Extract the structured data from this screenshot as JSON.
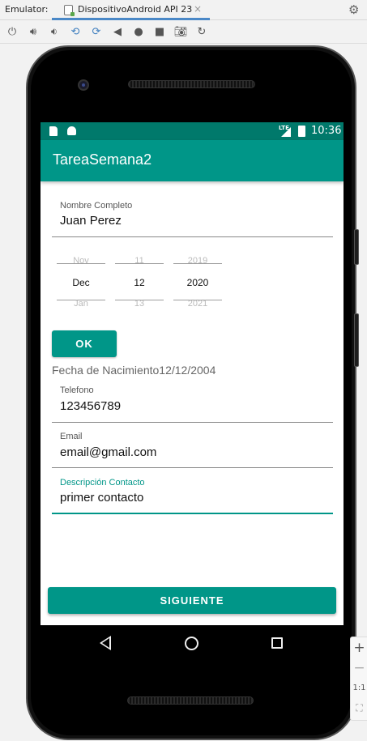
{
  "ide": {
    "emulator_label": "Emulator:",
    "tab_title": "DispositivoAndroid API 23",
    "tab_close": "×",
    "settings_icon": "gear-icon",
    "toolbar_icons": [
      "power-icon",
      "volume-up-icon",
      "volume-down-icon",
      "rotate-left-icon",
      "rotate-right-icon",
      "back-icon",
      "home-icon",
      "overview-icon",
      "screenshot-icon",
      "snapshot-icon"
    ]
  },
  "status_bar": {
    "network": "LTE",
    "time": "10:36"
  },
  "app_bar": {
    "title": "TareaSemana2"
  },
  "form": {
    "nombre": {
      "hint": "Nombre Completo",
      "value": "Juan Perez"
    },
    "date_picker": {
      "month": {
        "prev": "Nov",
        "current": "Dec",
        "next": "Jan"
      },
      "day": {
        "prev": "11",
        "current": "12",
        "next": "13"
      },
      "year": {
        "prev": "2019",
        "current": "2020",
        "next": "2021"
      }
    },
    "ok_button": "OK",
    "fecha_label": "Fecha de Nacimiento12/12/2004",
    "telefono": {
      "hint": "Telefono",
      "value": "123456789"
    },
    "email": {
      "hint": "Email",
      "value": "email@gmail.com"
    },
    "descripcion": {
      "hint": "Descripción Contacto",
      "value": "primer contacto"
    },
    "siguiente_button": "SIGUIENTE"
  },
  "zoom_panel": {
    "zoom_in": "+",
    "zoom_out": "−",
    "actual_size": "1:1"
  },
  "colors": {
    "primary": "#009688",
    "primary_dark": "#00796b",
    "accent": "#009688"
  }
}
